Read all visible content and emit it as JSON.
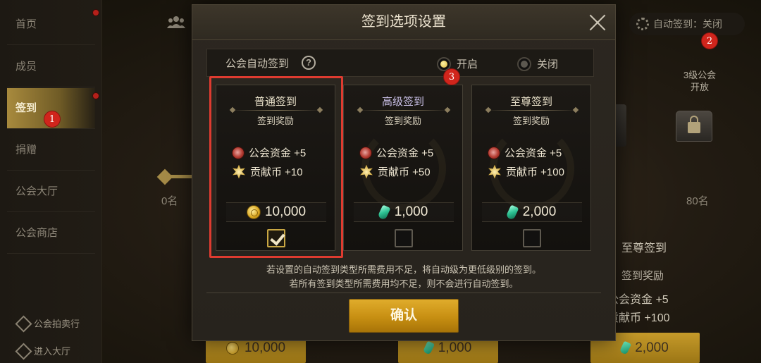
{
  "sidebar": {
    "items": [
      {
        "label": "首页"
      },
      {
        "label": "成员"
      },
      {
        "label": "签到"
      },
      {
        "label": "捐赠"
      },
      {
        "label": "公会大厅"
      },
      {
        "label": "公会商店"
      }
    ],
    "bottom": [
      {
        "label": "公会拍卖行"
      },
      {
        "label": "进入大厅"
      }
    ]
  },
  "markers": [
    "1",
    "2",
    "3"
  ],
  "topbar": {
    "auto_sign_status": "自动签到：关闭"
  },
  "background": {
    "rank_left": "0名",
    "rank_right": "80名",
    "chest_label": "3级公会\n开放",
    "card_title": "至尊签到",
    "card_sub": "签到奖励",
    "card_reward1": "公会资金 +5",
    "card_reward2": "贡献币 +100",
    "costs": [
      "10,000",
      "1,000",
      "2,000"
    ]
  },
  "modal": {
    "title": "签到选项设置",
    "option_label": "公会自动签到",
    "help_symbol": "?",
    "radio_on": "开启",
    "radio_off": "关闭",
    "selected_option": "开启",
    "cards": [
      {
        "title": "普通签到",
        "sub": "签到奖励",
        "reward1": "公会资金 +5",
        "reward2": "贡献币 +10",
        "cost": "10,000",
        "currency": "coin",
        "checked": true
      },
      {
        "title": "高级签到",
        "sub": "签到奖励",
        "reward1": "公会资金 +5",
        "reward2": "贡献币 +50",
        "cost": "1,000",
        "currency": "gem",
        "checked": false
      },
      {
        "title": "至尊签到",
        "sub": "签到奖励",
        "reward1": "公会资金 +5",
        "reward2": "贡献币 +100",
        "cost": "2,000",
        "currency": "gem",
        "checked": false
      }
    ],
    "note1": "若设置的自动签到类型所需费用不足，将自动级为更低级别的签到。",
    "note2": "若所有签到类型所需费用均不足，则不会进行自动签到。",
    "confirm": "确认"
  },
  "colors": {
    "accent_gold": "#c78f12",
    "highlight_red": "#de3b30",
    "marker_red": "#d0251c"
  }
}
